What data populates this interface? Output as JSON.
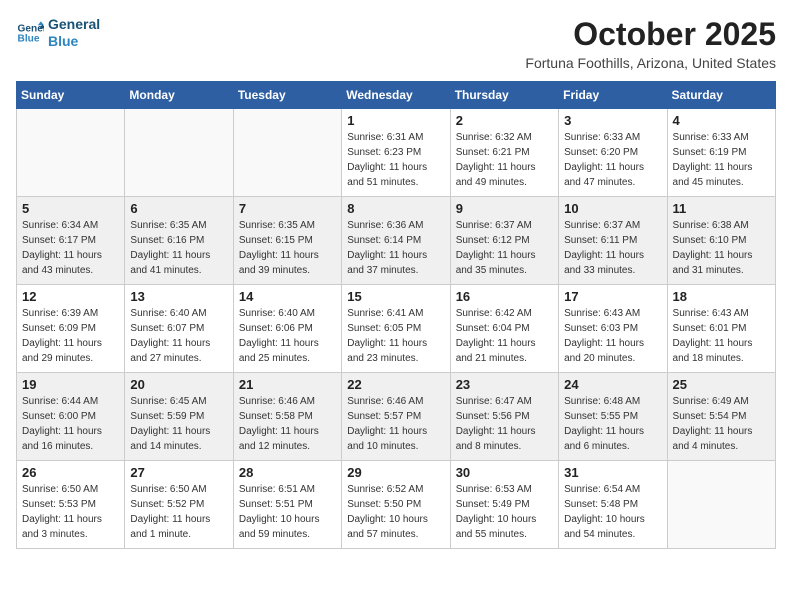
{
  "logo": {
    "line1": "General",
    "line2": "Blue"
  },
  "header": {
    "month": "October 2025",
    "location": "Fortuna Foothills, Arizona, United States"
  },
  "weekdays": [
    "Sunday",
    "Monday",
    "Tuesday",
    "Wednesday",
    "Thursday",
    "Friday",
    "Saturday"
  ],
  "weeks": [
    [
      {
        "day": "",
        "info": ""
      },
      {
        "day": "",
        "info": ""
      },
      {
        "day": "",
        "info": ""
      },
      {
        "day": "1",
        "info": "Sunrise: 6:31 AM\nSunset: 6:23 PM\nDaylight: 11 hours\nand 51 minutes."
      },
      {
        "day": "2",
        "info": "Sunrise: 6:32 AM\nSunset: 6:21 PM\nDaylight: 11 hours\nand 49 minutes."
      },
      {
        "day": "3",
        "info": "Sunrise: 6:33 AM\nSunset: 6:20 PM\nDaylight: 11 hours\nand 47 minutes."
      },
      {
        "day": "4",
        "info": "Sunrise: 6:33 AM\nSunset: 6:19 PM\nDaylight: 11 hours\nand 45 minutes."
      }
    ],
    [
      {
        "day": "5",
        "info": "Sunrise: 6:34 AM\nSunset: 6:17 PM\nDaylight: 11 hours\nand 43 minutes."
      },
      {
        "day": "6",
        "info": "Sunrise: 6:35 AM\nSunset: 6:16 PM\nDaylight: 11 hours\nand 41 minutes."
      },
      {
        "day": "7",
        "info": "Sunrise: 6:35 AM\nSunset: 6:15 PM\nDaylight: 11 hours\nand 39 minutes."
      },
      {
        "day": "8",
        "info": "Sunrise: 6:36 AM\nSunset: 6:14 PM\nDaylight: 11 hours\nand 37 minutes."
      },
      {
        "day": "9",
        "info": "Sunrise: 6:37 AM\nSunset: 6:12 PM\nDaylight: 11 hours\nand 35 minutes."
      },
      {
        "day": "10",
        "info": "Sunrise: 6:37 AM\nSunset: 6:11 PM\nDaylight: 11 hours\nand 33 minutes."
      },
      {
        "day": "11",
        "info": "Sunrise: 6:38 AM\nSunset: 6:10 PM\nDaylight: 11 hours\nand 31 minutes."
      }
    ],
    [
      {
        "day": "12",
        "info": "Sunrise: 6:39 AM\nSunset: 6:09 PM\nDaylight: 11 hours\nand 29 minutes."
      },
      {
        "day": "13",
        "info": "Sunrise: 6:40 AM\nSunset: 6:07 PM\nDaylight: 11 hours\nand 27 minutes."
      },
      {
        "day": "14",
        "info": "Sunrise: 6:40 AM\nSunset: 6:06 PM\nDaylight: 11 hours\nand 25 minutes."
      },
      {
        "day": "15",
        "info": "Sunrise: 6:41 AM\nSunset: 6:05 PM\nDaylight: 11 hours\nand 23 minutes."
      },
      {
        "day": "16",
        "info": "Sunrise: 6:42 AM\nSunset: 6:04 PM\nDaylight: 11 hours\nand 21 minutes."
      },
      {
        "day": "17",
        "info": "Sunrise: 6:43 AM\nSunset: 6:03 PM\nDaylight: 11 hours\nand 20 minutes."
      },
      {
        "day": "18",
        "info": "Sunrise: 6:43 AM\nSunset: 6:01 PM\nDaylight: 11 hours\nand 18 minutes."
      }
    ],
    [
      {
        "day": "19",
        "info": "Sunrise: 6:44 AM\nSunset: 6:00 PM\nDaylight: 11 hours\nand 16 minutes."
      },
      {
        "day": "20",
        "info": "Sunrise: 6:45 AM\nSunset: 5:59 PM\nDaylight: 11 hours\nand 14 minutes."
      },
      {
        "day": "21",
        "info": "Sunrise: 6:46 AM\nSunset: 5:58 PM\nDaylight: 11 hours\nand 12 minutes."
      },
      {
        "day": "22",
        "info": "Sunrise: 6:46 AM\nSunset: 5:57 PM\nDaylight: 11 hours\nand 10 minutes."
      },
      {
        "day": "23",
        "info": "Sunrise: 6:47 AM\nSunset: 5:56 PM\nDaylight: 11 hours\nand 8 minutes."
      },
      {
        "day": "24",
        "info": "Sunrise: 6:48 AM\nSunset: 5:55 PM\nDaylight: 11 hours\nand 6 minutes."
      },
      {
        "day": "25",
        "info": "Sunrise: 6:49 AM\nSunset: 5:54 PM\nDaylight: 11 hours\nand 4 minutes."
      }
    ],
    [
      {
        "day": "26",
        "info": "Sunrise: 6:50 AM\nSunset: 5:53 PM\nDaylight: 11 hours\nand 3 minutes."
      },
      {
        "day": "27",
        "info": "Sunrise: 6:50 AM\nSunset: 5:52 PM\nDaylight: 11 hours\nand 1 minute."
      },
      {
        "day": "28",
        "info": "Sunrise: 6:51 AM\nSunset: 5:51 PM\nDaylight: 10 hours\nand 59 minutes."
      },
      {
        "day": "29",
        "info": "Sunrise: 6:52 AM\nSunset: 5:50 PM\nDaylight: 10 hours\nand 57 minutes."
      },
      {
        "day": "30",
        "info": "Sunrise: 6:53 AM\nSunset: 5:49 PM\nDaylight: 10 hours\nand 55 minutes."
      },
      {
        "day": "31",
        "info": "Sunrise: 6:54 AM\nSunset: 5:48 PM\nDaylight: 10 hours\nand 54 minutes."
      },
      {
        "day": "",
        "info": ""
      }
    ]
  ]
}
